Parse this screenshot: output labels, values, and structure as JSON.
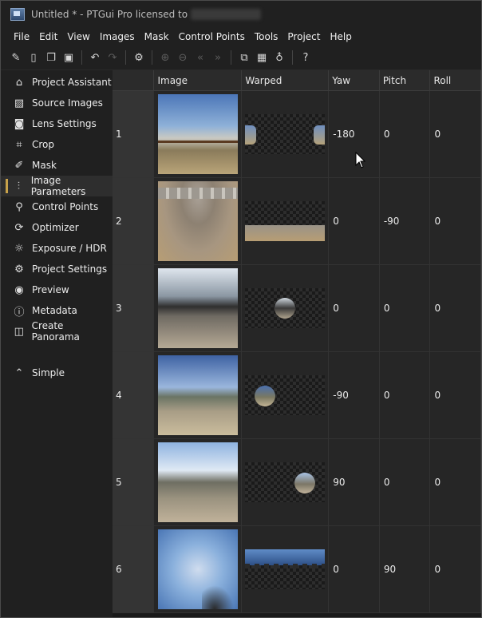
{
  "window": {
    "title": "Untitled * - PTGui Pro licensed to"
  },
  "menubar": [
    "File",
    "Edit",
    "View",
    "Images",
    "Mask",
    "Control Points",
    "Tools",
    "Project",
    "Help"
  ],
  "sidebar": {
    "items": [
      {
        "label": "Project Assistant",
        "icon": "home-icon",
        "active": false
      },
      {
        "label": "Source Images",
        "icon": "image-icon",
        "active": false
      },
      {
        "label": "Lens Settings",
        "icon": "camera-icon",
        "active": false
      },
      {
        "label": "Crop",
        "icon": "crop-icon",
        "active": false
      },
      {
        "label": "Mask",
        "icon": "pen-icon",
        "active": false
      },
      {
        "label": "Image Parameters",
        "icon": "sliders-icon",
        "active": true
      },
      {
        "label": "Control Points",
        "icon": "pin-icon",
        "active": false
      },
      {
        "label": "Optimizer",
        "icon": "refresh-icon",
        "active": false
      },
      {
        "label": "Exposure / HDR",
        "icon": "sun-icon",
        "active": false
      },
      {
        "label": "Project Settings",
        "icon": "gear-icon",
        "active": false
      },
      {
        "label": "Preview",
        "icon": "eye-icon",
        "active": false
      },
      {
        "label": "Metadata",
        "icon": "info-icon",
        "active": false
      },
      {
        "label": "Create Panorama",
        "icon": "panorama-icon",
        "active": false
      }
    ],
    "simple": {
      "label": "Simple",
      "icon": "chevron-up-circle-icon"
    }
  },
  "table": {
    "columns": [
      "",
      "Image",
      "Warped",
      "Yaw",
      "Pitch",
      "Roll"
    ],
    "rows": [
      {
        "num": "1",
        "yaw": "-180",
        "pitch": "0",
        "roll": "0"
      },
      {
        "num": "2",
        "yaw": "0",
        "pitch": "-90",
        "roll": "0"
      },
      {
        "num": "3",
        "yaw": "0",
        "pitch": "0",
        "roll": "0"
      },
      {
        "num": "4",
        "yaw": "-90",
        "pitch": "0",
        "roll": "0"
      },
      {
        "num": "5",
        "yaw": "90",
        "pitch": "0",
        "roll": "0"
      },
      {
        "num": "6",
        "yaw": "0",
        "pitch": "90",
        "roll": "0"
      }
    ]
  },
  "colors": {
    "accent": "#c8a24a",
    "background": "#202020",
    "table_bg": "#262626"
  }
}
